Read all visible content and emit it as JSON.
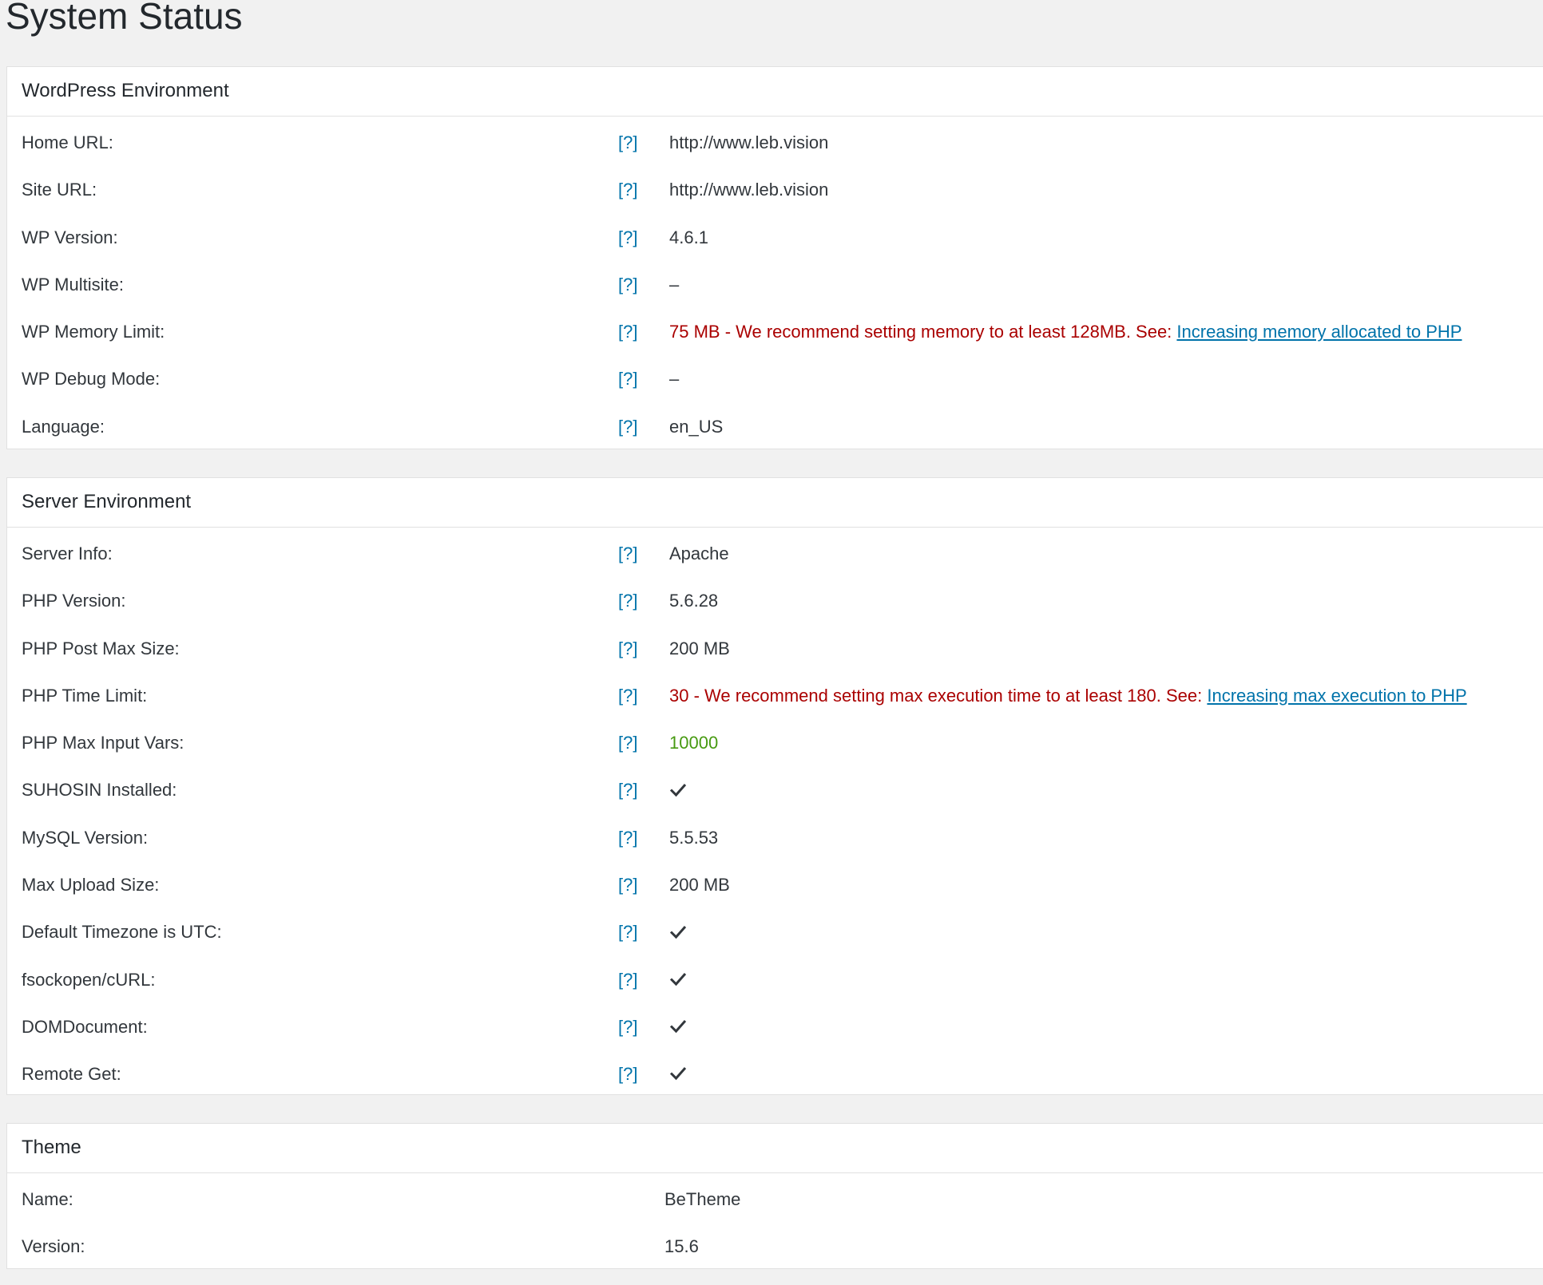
{
  "page": {
    "title": "System Status"
  },
  "colors": {
    "link": "#0073aa",
    "error": "#aa0000",
    "good": "#479a11",
    "text": "#32373c"
  },
  "wp_env": {
    "title": "WordPress Environment",
    "rows": [
      {
        "label": "Home URL:",
        "help": "[?]",
        "value": "http://www.leb.vision"
      },
      {
        "label": "Site URL:",
        "help": "[?]",
        "value": "http://www.leb.vision"
      },
      {
        "label": "WP Version:",
        "help": "[?]",
        "value": "4.6.1"
      },
      {
        "label": "WP Multisite:",
        "help": "[?]",
        "value": "–"
      },
      {
        "label": "WP Memory Limit:",
        "help": "[?]",
        "value": "75 MB - We recommend setting memory to at least 128MB. See: ",
        "link": "Increasing memory allocated to PHP"
      },
      {
        "label": "WP Debug Mode:",
        "help": "[?]",
        "value": "–"
      },
      {
        "label": "Language:",
        "help": "[?]",
        "value": "en_US"
      }
    ]
  },
  "server_env": {
    "title": "Server Environment",
    "rows": [
      {
        "label": "Server Info:",
        "help": "[?]",
        "value": "Apache"
      },
      {
        "label": "PHP Version:",
        "help": "[?]",
        "value": "5.6.28"
      },
      {
        "label": "PHP Post Max Size:",
        "help": "[?]",
        "value": "200 MB"
      },
      {
        "label": "PHP Time Limit:",
        "help": "[?]",
        "value": "30 - We recommend setting max execution time to at least 180. See: ",
        "link": "Increasing max execution to PHP"
      },
      {
        "label": "PHP Max Input Vars:",
        "help": "[?]",
        "value": "10000"
      },
      {
        "label": "SUHOSIN Installed:",
        "help": "[?]",
        "icon": "check-icon"
      },
      {
        "label": "MySQL Version:",
        "help": "[?]",
        "value": "5.5.53"
      },
      {
        "label": "Max Upload Size:",
        "help": "[?]",
        "value": "200 MB"
      },
      {
        "label": "Default Timezone is UTC:",
        "help": "[?]",
        "icon": "check-icon"
      },
      {
        "label": "fsockopen/cURL:",
        "help": "[?]",
        "icon": "check-icon"
      },
      {
        "label": "DOMDocument:",
        "help": "[?]",
        "icon": "check-icon"
      },
      {
        "label": "Remote Get:",
        "help": "[?]",
        "icon": "check-icon"
      }
    ]
  },
  "theme": {
    "title": "Theme",
    "rows": [
      {
        "label": "Name:",
        "value": "BeTheme"
      },
      {
        "label": "Version:",
        "value": "15.6"
      }
    ]
  }
}
